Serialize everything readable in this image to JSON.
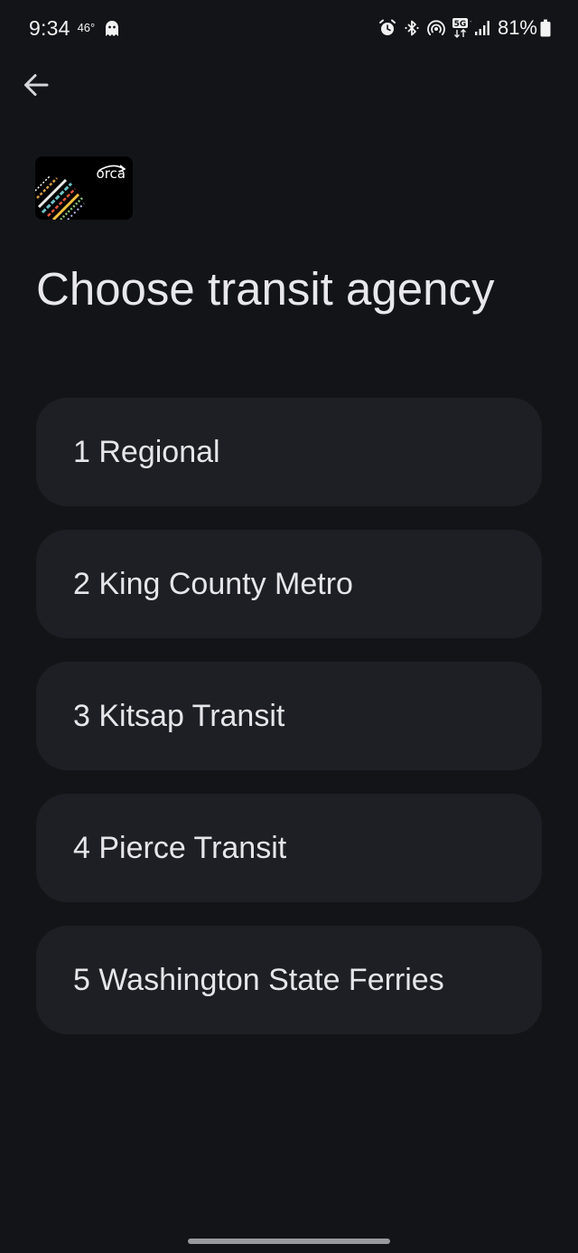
{
  "status_bar": {
    "time": "9:34",
    "temperature": "46°",
    "battery_percent": "81%",
    "network": "5G",
    "icons": [
      "ghost-icon",
      "alarm-icon",
      "bluetooth-icon",
      "hotspot-icon",
      "5g-icon",
      "signal-icon",
      "battery-icon"
    ]
  },
  "header": {
    "back_icon": "arrow-left-icon"
  },
  "card": {
    "logo_text": "orca"
  },
  "page": {
    "title": "Choose transit agency"
  },
  "agencies": [
    {
      "label": "1 Regional"
    },
    {
      "label": "2 King County Metro"
    },
    {
      "label": "3 Kitsap Transit"
    },
    {
      "label": "4 Pierce Transit"
    },
    {
      "label": "5 Washington State Ferries"
    }
  ],
  "colors": {
    "background": "#131418",
    "item_background": "#1e1f24",
    "text": "#e6e6ea"
  }
}
